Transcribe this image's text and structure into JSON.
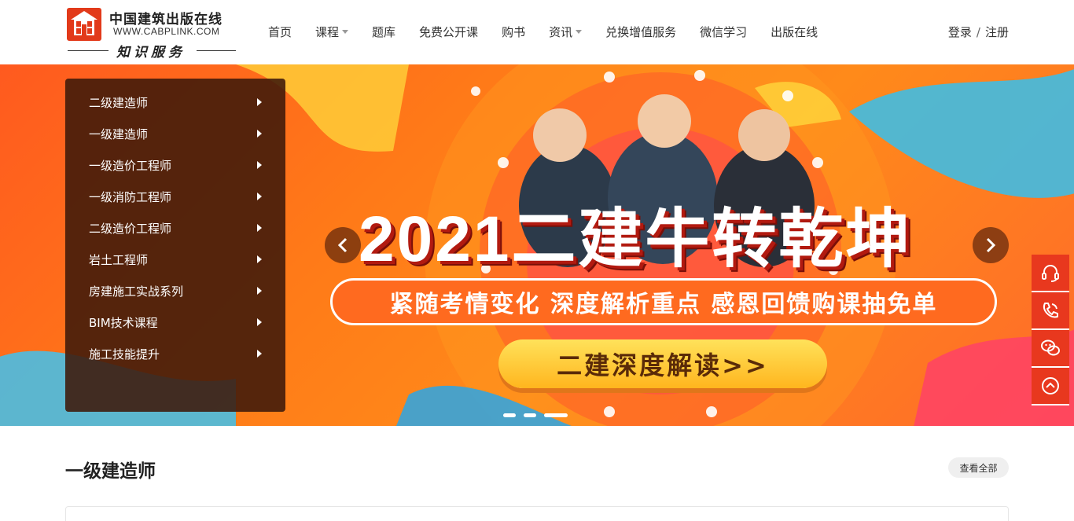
{
  "logo": {
    "title_cn": "中国建筑出版在线",
    "url": "WWW.CABPLINK.COM",
    "slogan": "知识服务"
  },
  "nav": {
    "items": [
      {
        "label": "首页",
        "dropdown": false
      },
      {
        "label": "课程",
        "dropdown": true
      },
      {
        "label": "题库",
        "dropdown": false
      },
      {
        "label": "免费公开课",
        "dropdown": false
      },
      {
        "label": "购书",
        "dropdown": false
      },
      {
        "label": "资讯",
        "dropdown": true
      },
      {
        "label": "兑换增值服务",
        "dropdown": false
      },
      {
        "label": "微信学习",
        "dropdown": false
      },
      {
        "label": "出版在线",
        "dropdown": false
      }
    ],
    "login": "登录",
    "separator": "/",
    "register": "注册"
  },
  "sidebar": {
    "items": [
      {
        "label": "二级建造师"
      },
      {
        "label": "一级建造师"
      },
      {
        "label": "一级造价工程师"
      },
      {
        "label": "一级消防工程师"
      },
      {
        "label": "二级造价工程师"
      },
      {
        "label": "岩土工程师"
      },
      {
        "label": "房建施工实战系列"
      },
      {
        "label": "BIM技术课程"
      },
      {
        "label": "施工技能提升"
      }
    ]
  },
  "banner": {
    "headline": "2021二建牛转乾坤",
    "subtitle": "紧随考情变化 深度解析重点 感恩回馈购课抽免单",
    "cta": "二建深度解读>>",
    "slides_count": 3,
    "active_slide": 3,
    "colors": {
      "accent": "#ff6a1f",
      "dark": "#3e190a"
    }
  },
  "side_tools": {
    "items": [
      {
        "icon": "headset-icon"
      },
      {
        "icon": "phone-icon"
      },
      {
        "icon": "wechat-icon"
      },
      {
        "icon": "back-to-top-icon"
      }
    ],
    "color": "#e8381e"
  },
  "section": {
    "title": "一级建造师",
    "view_all": "查看全部"
  }
}
